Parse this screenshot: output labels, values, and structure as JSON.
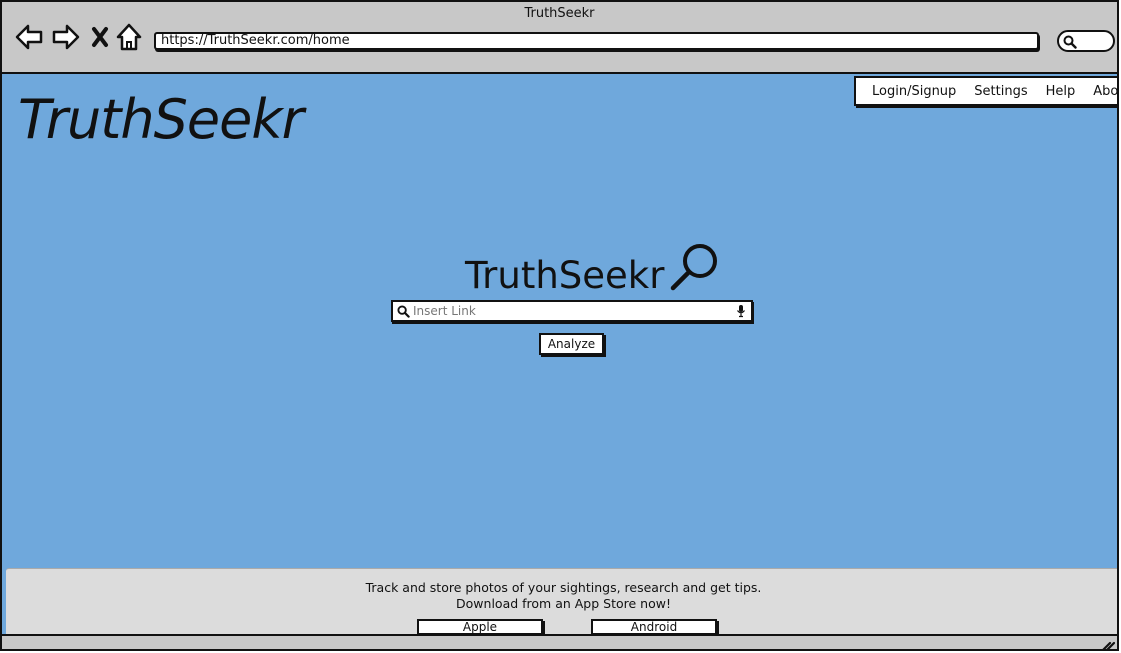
{
  "window": {
    "title": "TruthSeekr"
  },
  "browser": {
    "url": "https://TruthSeekr.com/home",
    "icons": [
      "back-arrow-icon",
      "forward-arrow-icon",
      "close-x-icon",
      "home-icon",
      "search-icon"
    ]
  },
  "header": {
    "brand": "TruthSeekr",
    "menu": [
      {
        "label": "Login/Signup"
      },
      {
        "label": "Settings"
      },
      {
        "label": "Help"
      },
      {
        "label": "About"
      }
    ]
  },
  "main": {
    "logo_text": "TruthSeekr",
    "search": {
      "placeholder": "Insert Link",
      "value": ""
    },
    "analyze_label": "Analyze"
  },
  "footer": {
    "line1": "Track and store photos of your sightings, research and get tips.",
    "line2": "Download from an App Store now!",
    "apple_label": "Apple",
    "android_label": "Android"
  },
  "colors": {
    "page_bg": "#6fa8dc",
    "chrome_bg": "#c8c8c8",
    "footer_bg": "#dcdcdc"
  }
}
